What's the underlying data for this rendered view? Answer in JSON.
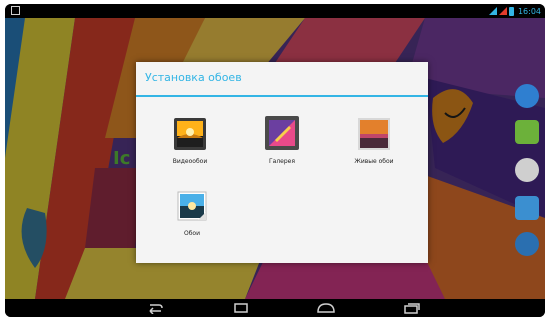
{
  "status_bar": {
    "time": "16:04"
  },
  "dialog": {
    "title": "Установка обоев",
    "options": [
      {
        "label": "Видеообои",
        "icon": "video-wallpaper-icon"
      },
      {
        "label": "Галерея",
        "icon": "gallery-icon"
      },
      {
        "label": "Живые обои",
        "icon": "live-wallpaper-icon"
      },
      {
        "label": "Обои",
        "icon": "wallpaper-icon"
      }
    ]
  },
  "navigation_bar": {
    "buttons": [
      "back-icon",
      "menu-icon",
      "home-icon",
      "recent-apps-icon"
    ]
  },
  "colors": {
    "accent": "#33b5e5",
    "dialog_background": "#f4f4f4",
    "status_bar": "#000000"
  }
}
